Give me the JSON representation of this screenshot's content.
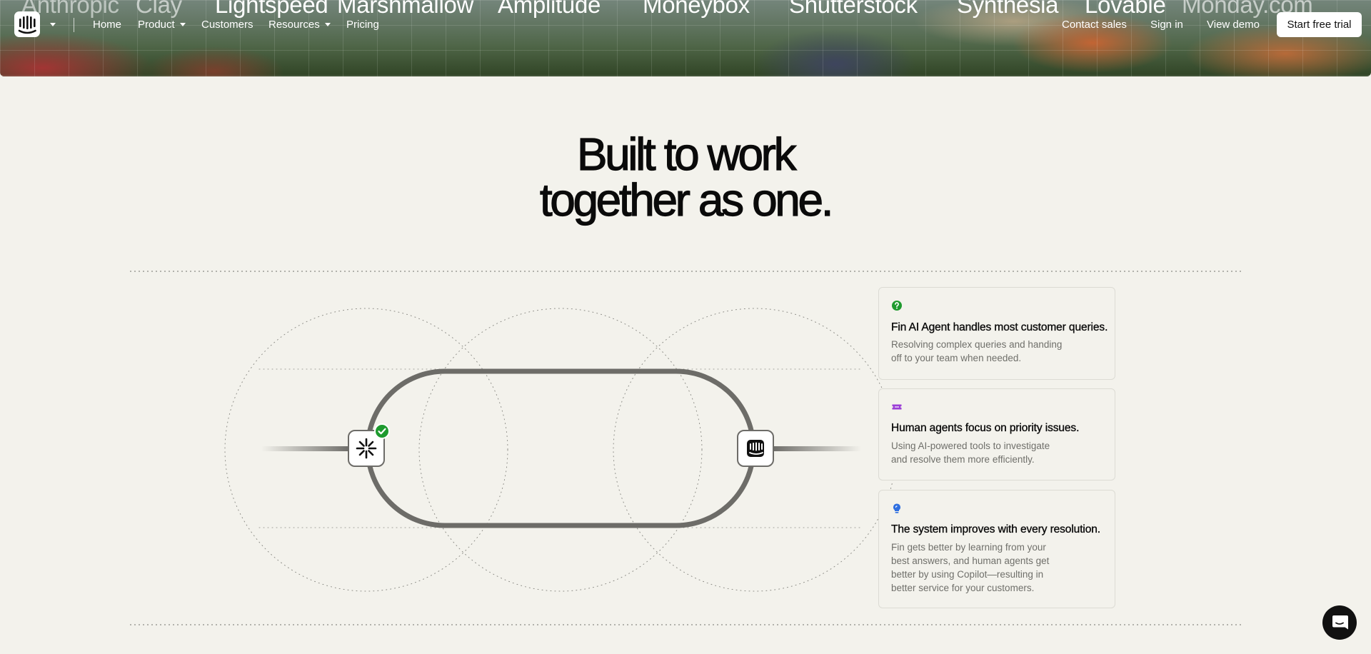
{
  "hero": {
    "logo_wall": [
      "Anthropic",
      "Clay",
      "Lightspeed",
      "Marshmallow",
      "Amplitude",
      "Moneybox",
      "Shutterstock",
      "Synthesia",
      "Lovable",
      "Monday.com"
    ]
  },
  "nav": {
    "logo_icon": "intercom-logo-icon",
    "links": {
      "home": "Home",
      "product": "Product",
      "customers": "Customers",
      "resources": "Resources",
      "pricing": "Pricing"
    },
    "right": {
      "contact_sales": "Contact sales",
      "sign_in": "Sign in",
      "view_demo": "View demo",
      "start_trial": "Start free trial"
    }
  },
  "main": {
    "headline_line1": "Built to work",
    "headline_line2": "together as one."
  },
  "diagram": {
    "left_node_icon": "fin-ai-icon",
    "right_node_icon": "intercom-logo-icon",
    "badge_icon": "check-icon"
  },
  "cards": [
    {
      "icon": "question-circle-icon",
      "icon_color": "#1e9a2e",
      "title": "Fin AI Agent handles most customer queries.",
      "desc_lines": [
        "Resolving complex queries and handing",
        "off to your team when needed."
      ]
    },
    {
      "icon": "ticket-icon",
      "icon_color": "#9b3fd6",
      "title": "Human agents focus on priority issues.",
      "desc_lines": [
        "Using AI-powered tools to investigate",
        "and resolve them more efficiently."
      ]
    },
    {
      "icon": "lightbulb-icon",
      "icon_color": "#2f6fe0",
      "title": "The system improves with every resolution.",
      "desc_lines": [
        "Fin gets better by learning from your",
        "best answers, and human agents get",
        "better by using Copilot—resulting in",
        "better service for your customers."
      ]
    }
  ],
  "chat": {
    "icon": "chat-bubble-icon"
  },
  "colors": {
    "page_bg": "#f3f2ec",
    "track": "#6d6c68",
    "check_green": "#1e9a2e"
  }
}
